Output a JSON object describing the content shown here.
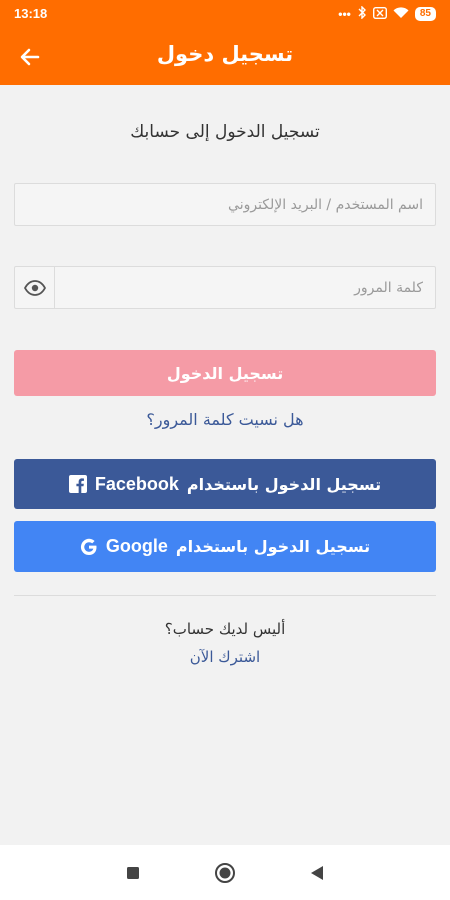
{
  "status": {
    "time": "13:18",
    "battery": "85"
  },
  "appbar": {
    "title": "تسجيل دخول"
  },
  "form": {
    "subtitle": "تسجيل الدخول إلى حسابك",
    "username_placeholder": "اسم المستخدم / البريد الإلكتروني",
    "username_value": "",
    "password_placeholder": "كلمة المرور",
    "password_value": "",
    "login_label": "تسجيل الدخول",
    "forgot_label": "هل نسيت كلمة المرور؟"
  },
  "social": {
    "facebook_label": "تسجيل الدخول باستخدام",
    "facebook_brand": "Facebook",
    "google_label": "تسجيل الدخول باستخدام",
    "google_brand": "Google"
  },
  "signup": {
    "prompt": "أليس لديك حساب؟",
    "link": "اشترك الآن"
  },
  "colors": {
    "accent": "#ff6d00",
    "facebook": "#3b5998",
    "google": "#4285f4",
    "login_disabled": "#f59ba6"
  },
  "icons": {
    "back": "arrow-left-icon",
    "eye": "eye-icon",
    "facebook": "facebook-icon",
    "google": "google-icon"
  }
}
